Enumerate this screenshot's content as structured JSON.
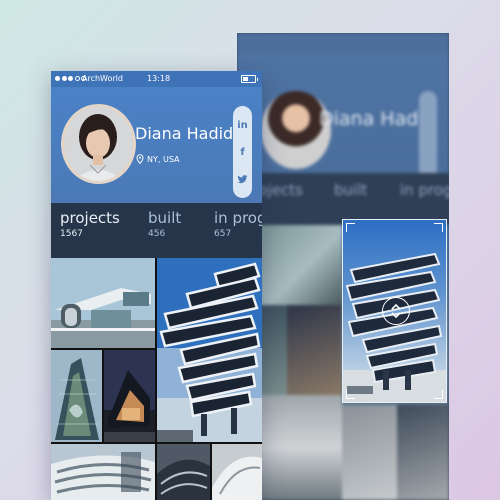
{
  "status_bar": {
    "carrier": "ArchWorld",
    "time": "13:18"
  },
  "profile": {
    "name": "Diana Hadid",
    "location": "NY, USA"
  },
  "social": {
    "linkedin": "in",
    "facebook": "f",
    "twitter": "t"
  },
  "stats": [
    {
      "label": "projects",
      "value": "1567"
    },
    {
      "label": "built",
      "value": "456"
    },
    {
      "label": "in progress",
      "value": "657"
    }
  ],
  "colors": {
    "accent": "#4a82c6",
    "stats_bg": "#263549",
    "social_pill": "#dce7f4"
  },
  "icons": [
    "location-pin-icon",
    "linkedin-icon",
    "facebook-icon",
    "twitter-icon",
    "expand-icon"
  ]
}
